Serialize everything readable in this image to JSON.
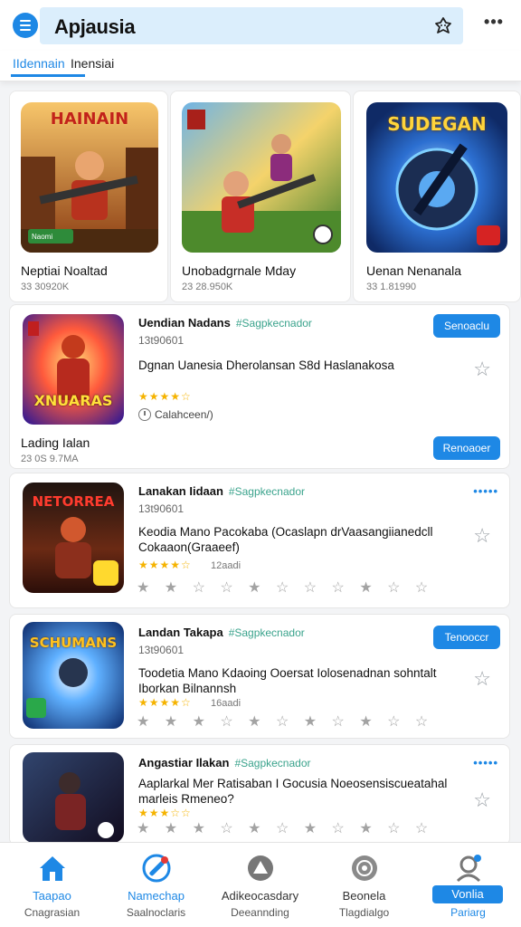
{
  "header": {
    "title": "Apjausia",
    "tabs": [
      {
        "label": "IIdennain"
      },
      {
        "label": "Inensiai"
      }
    ]
  },
  "featured": [
    {
      "title": "Neptiai Noaltad",
      "meta": "33 30920K",
      "thumb_text": "HAINAIN",
      "badge": "Naomi"
    },
    {
      "title": "Unobadgrnale Mday",
      "meta": "23 28.950K",
      "thumb_text": "",
      "badge": ""
    },
    {
      "title": "Uenan Nenanala",
      "meta": "33 1.81990",
      "thumb_text": "SUDEGAN",
      "badge": ""
    }
  ],
  "list": [
    {
      "name": "Uendian Nadans",
      "tag": "#Sagpkecnador",
      "sub": "13t90601",
      "desc": "Dgnan Uanesia Dherolansan S8d Haslanakosa",
      "stars": "★★★★☆",
      "clock_text": "Calahceen/)",
      "button_top": "Senoaclu",
      "title_below": "Lading Ialan",
      "meta_below": "23 0S 9.7MA",
      "button_bottom": "Renoaoer",
      "thumb_text": "XNUARAS"
    },
    {
      "name": "Lanakan Iidaan",
      "tag": "#Sagpkecnador",
      "sub": "13t90601",
      "desc": "Keodia Mano Pacokaba (Ocaslapn drVaasangiianedcll Cokaaon(Graaeef)",
      "stars": "★★★★☆",
      "rating_count": "12aadi",
      "dots": "•••••",
      "strip": "★ ★ ☆ ☆   ★ ☆ ☆ ☆ ★ ☆ ☆",
      "thumb_text": "NETORREA"
    },
    {
      "name": "Landan Takapa",
      "tag": "#Sagpkecnador",
      "sub": "13t90601",
      "desc": "Toodetia Mano Kdaoing Ooersat Iolosenadnan sohntalt Iborkan Bilnannsh",
      "stars": "★★★★☆",
      "rating_count": "16aadi",
      "button_top": "Tenooccr",
      "strip": "★ ★ ★ ☆   ★ ☆ ★ ☆ ★ ☆ ☆",
      "thumb_text": "SCHUMANS"
    },
    {
      "name": "Angastiar Ilakan",
      "tag": "#Sagpkecnador",
      "desc": "Aaplarkal Mer Ratisaban I Gocusia Noeosensiscueatahal marleis Rmeneo?",
      "stars": "★★★☆☆",
      "dots": "•••••",
      "strip": "★ ★ ★ ☆   ★ ☆ ★ ☆ ★ ☆ ☆",
      "thumb_text": ""
    }
  ],
  "bottom_nav": [
    {
      "label1": "Taapao",
      "label2": "Cnagrasian",
      "icon": "home-icon"
    },
    {
      "label1": "Namechap",
      "label2": "Saalnoclaris",
      "icon": "tag-icon"
    },
    {
      "label1": "Adikeocasdary",
      "label2": "Deeannding",
      "icon": "leaf-icon"
    },
    {
      "label1": "Beonela",
      "label2": "Tlagdialgo",
      "icon": "globe-icon"
    },
    {
      "label1": "Vonlia",
      "label2": "Pariarg",
      "icon": "profile-icon"
    }
  ],
  "colors": {
    "accent": "#1e88e5",
    "search_bg": "#dbeefc",
    "star": "#f5b300"
  }
}
